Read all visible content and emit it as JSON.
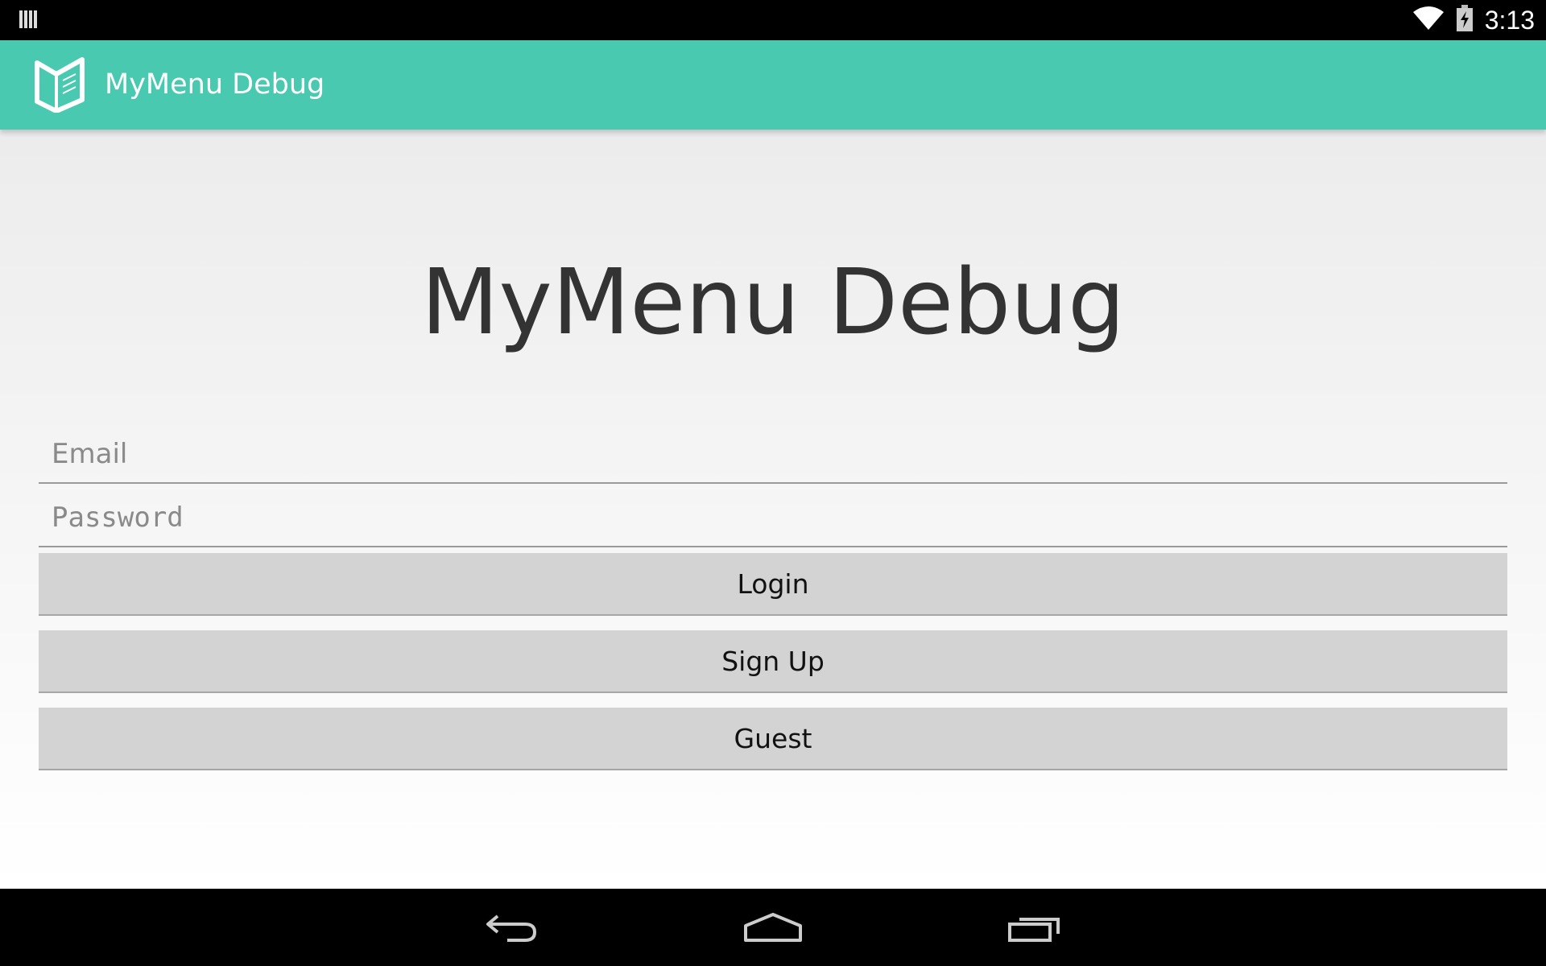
{
  "status_bar": {
    "time": "3:13",
    "icons": [
      "notification-bars-icon",
      "wifi-icon",
      "battery-charging-icon"
    ]
  },
  "action_bar": {
    "title": "MyMenu Debug",
    "icon": "app-logo-icon",
    "color": "#48c9b0"
  },
  "main": {
    "headline": "MyMenu Debug",
    "email": {
      "placeholder": "Email",
      "value": ""
    },
    "password": {
      "placeholder": "Password",
      "value": ""
    },
    "buttons": {
      "login": "Login",
      "signup": "Sign Up",
      "guest": "Guest"
    }
  },
  "nav_bar": {
    "icons": [
      "back-icon",
      "home-icon",
      "recent-apps-icon"
    ]
  }
}
